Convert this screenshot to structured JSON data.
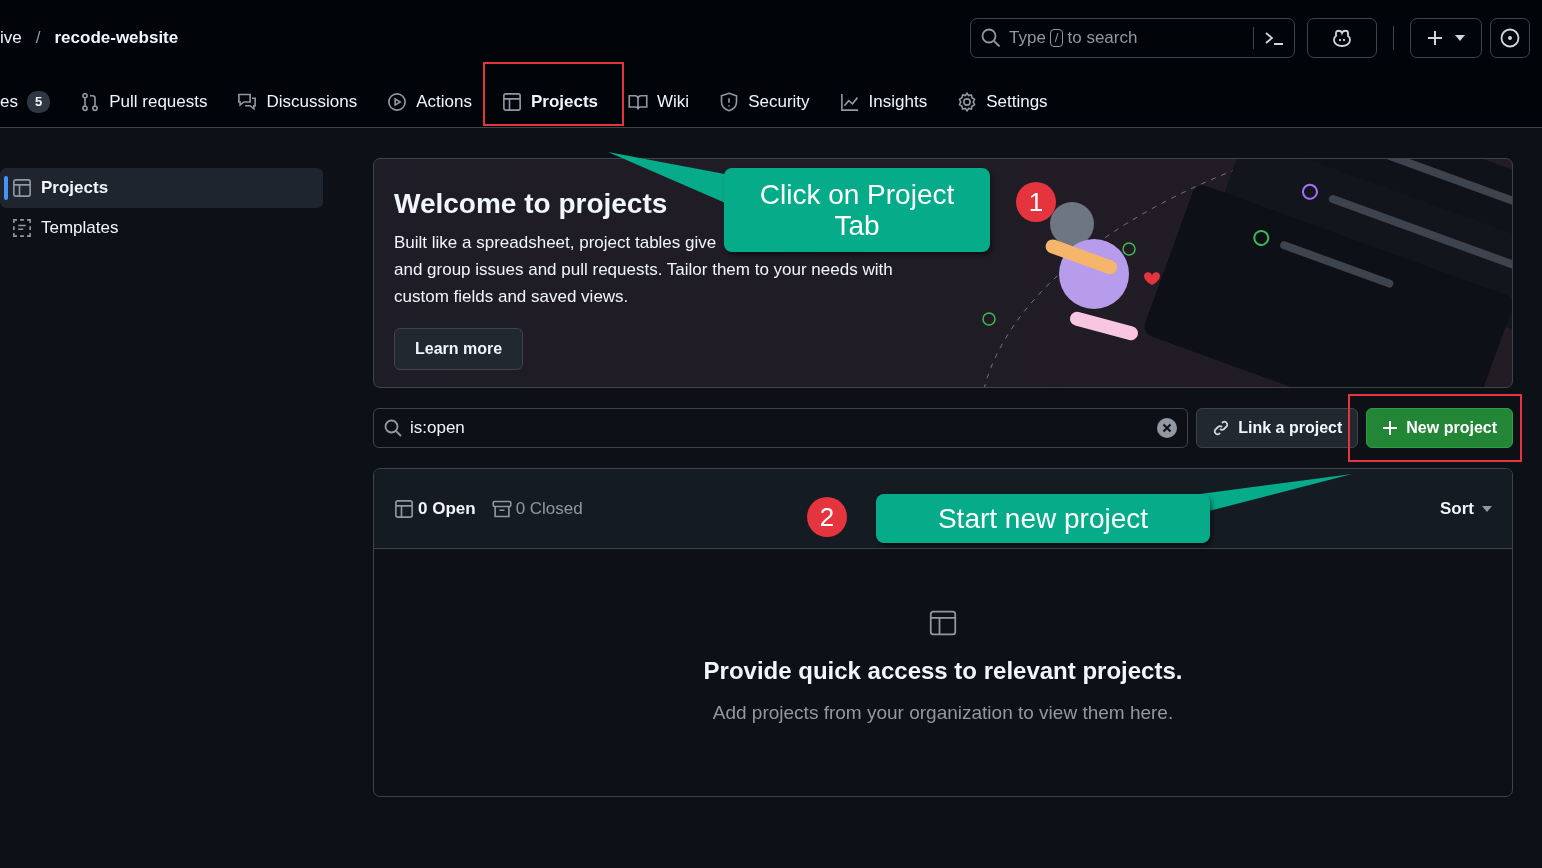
{
  "repo": {
    "owner": "ive",
    "separator": "/",
    "name": "recode-website"
  },
  "search": {
    "prefix": "Type",
    "key": "/",
    "suffix": "to search"
  },
  "tabs": [
    {
      "label": "es",
      "count": "5",
      "selected": false
    },
    {
      "label": "Pull requests",
      "selected": false
    },
    {
      "label": "Discussions",
      "selected": false
    },
    {
      "label": "Actions",
      "selected": false
    },
    {
      "label": "Projects",
      "selected": true
    },
    {
      "label": "Wiki",
      "selected": false
    },
    {
      "label": "Security",
      "selected": false
    },
    {
      "label": "Insights",
      "selected": false
    },
    {
      "label": "Settings",
      "selected": false
    }
  ],
  "sidebar": [
    {
      "label": "Projects",
      "selected": true
    },
    {
      "label": "Templates",
      "selected": false
    }
  ],
  "banner": {
    "title": "Welcome to projects",
    "body_lines": [
      "Built like a spreadsheet, project tables give",
      "and group issues and pull requests. Tailor them to your needs with",
      "custom fields and saved views."
    ],
    "button": "Learn more"
  },
  "filter": {
    "value": "is:open"
  },
  "link_button": "Link a project",
  "new_button": "New project",
  "list_header": {
    "states": [
      {
        "label": "0 Open",
        "selected": true
      },
      {
        "label": "0 Closed",
        "selected": false
      }
    ],
    "sort": "Sort"
  },
  "empty": {
    "title": "Provide quick access to relevant projects.",
    "body": "Add projects from your organization to view them here."
  },
  "annotations": [
    {
      "number": "1",
      "text": "Click on Project Tab"
    },
    {
      "number": "2",
      "text": "Start new project"
    }
  ]
}
